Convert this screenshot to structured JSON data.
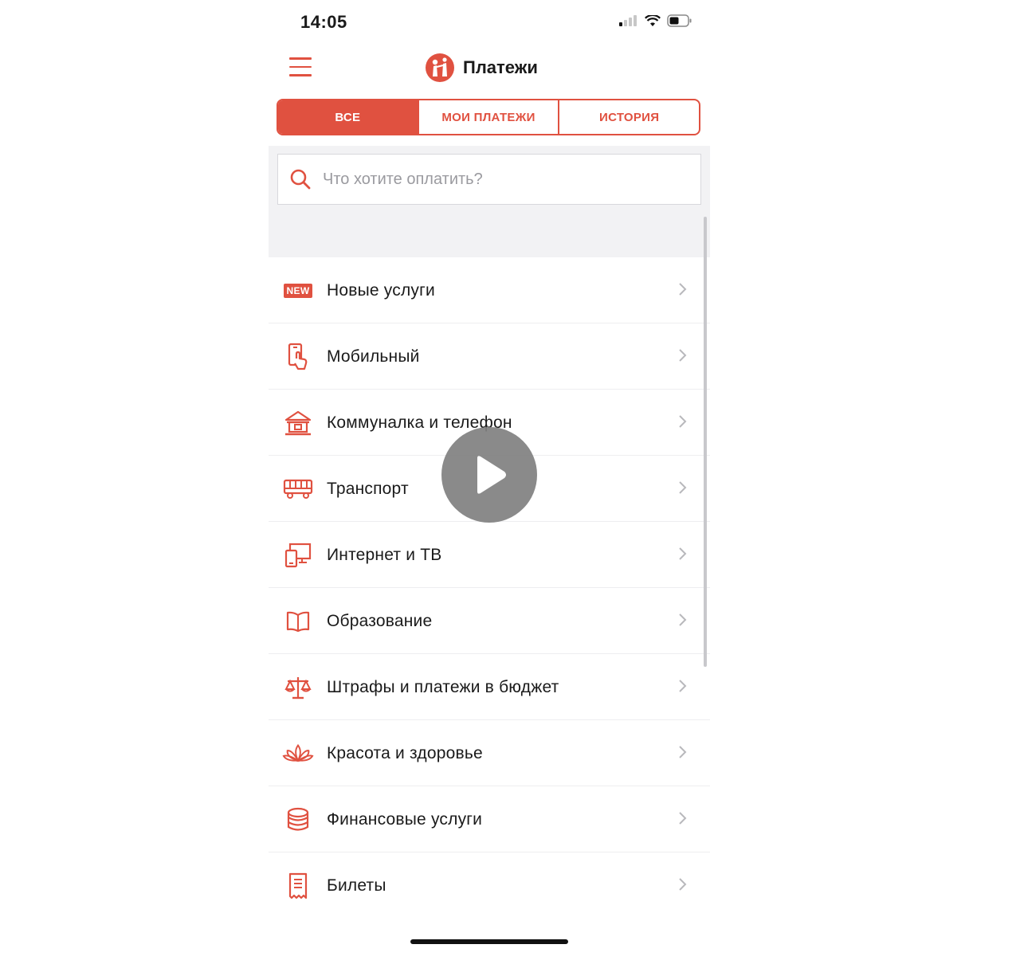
{
  "status": {
    "time": "14:05"
  },
  "header": {
    "title": "Платежи"
  },
  "tabs": [
    {
      "label": "ВСЕ",
      "active": true
    },
    {
      "label": "МОИ ПЛАТЕЖИ",
      "active": false
    },
    {
      "label": "ИСТОРИЯ",
      "active": false
    }
  ],
  "search": {
    "placeholder": "Что хотите оплатить?"
  },
  "categories": [
    {
      "label": "Новые услуги",
      "icon": "new-badge-icon",
      "badge": "NEW"
    },
    {
      "label": "Мобильный",
      "icon": "mobile-phone-icon"
    },
    {
      "label": "Коммуналка и телефон",
      "icon": "house-icon"
    },
    {
      "label": "Транспорт",
      "icon": "bus-icon"
    },
    {
      "label": "Интернет и ТВ",
      "icon": "devices-icon"
    },
    {
      "label": "Образование",
      "icon": "book-icon"
    },
    {
      "label": "Штрафы и платежи в бюджет",
      "icon": "scales-icon"
    },
    {
      "label": "Красота и здоровье",
      "icon": "lotus-icon"
    },
    {
      "label": "Финансовые услуги",
      "icon": "coins-icon"
    },
    {
      "label": "Билеты",
      "icon": "receipt-icon"
    }
  ],
  "colors": {
    "accent": "#e05140",
    "background_gray": "#f2f2f4"
  }
}
